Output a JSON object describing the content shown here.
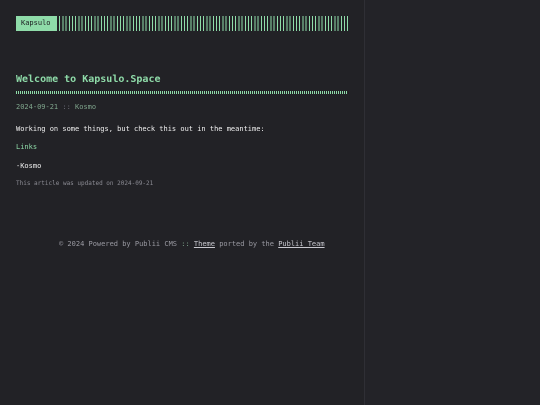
{
  "header": {
    "logo_label": "Kapsulo"
  },
  "post": {
    "title": "Welcome to Kapsulo.Space",
    "date": "2024-09-21",
    "meta_separator": "::",
    "author": "Kosmo",
    "body": "Working on some things, but check this out in the meantime:",
    "links_label": "Links",
    "signature": "-Kosmo",
    "updated_note": "This article was updated on 2024-09-21"
  },
  "footer": {
    "copyright": "© 2024 Powered by Publii CMS",
    "separator": "::",
    "theme_link": "Theme",
    "ported_by": "ported by the",
    "team_link": "Publii Team"
  },
  "colors": {
    "background": "#222226",
    "accent": "#8fdca9",
    "text": "#f2f2f2",
    "muted": "#8c8c94"
  }
}
